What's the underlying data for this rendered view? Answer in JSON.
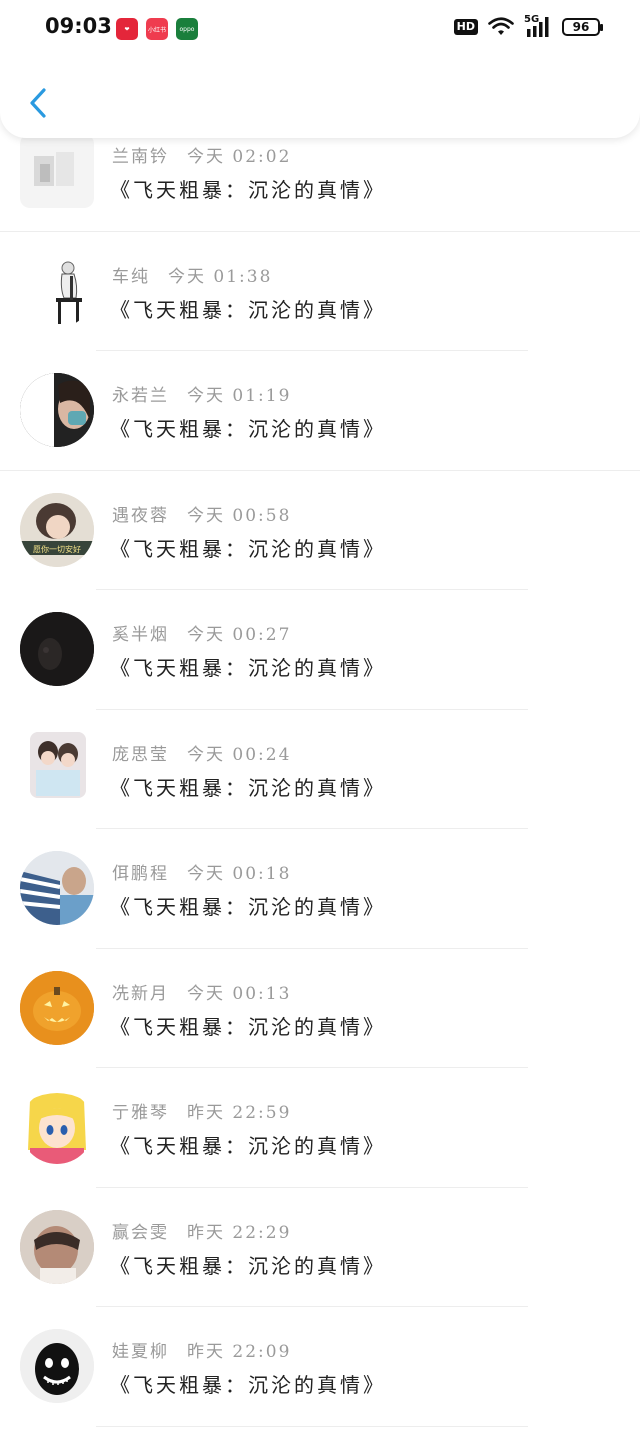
{
  "status_bar": {
    "time": "09:03",
    "badges": [
      {
        "text": "❤",
        "color": "#e4263a"
      },
      {
        "text": "小红书",
        "color": "#ef3c4f"
      },
      {
        "text": "oppo",
        "color": "#1a7f3c"
      }
    ],
    "hd": "HD",
    "network": "5G",
    "battery": "96"
  },
  "nav": {
    "back_icon": "chevron-left-icon"
  },
  "rows": [
    {
      "name": "兰南钤",
      "time": "今天 02:02",
      "title": "《飞天粗暴：沉沦的真情》"
    },
    {
      "name": "车纯",
      "time": "今天 01:38",
      "title": "《飞天粗暴：沉沦的真情》"
    },
    {
      "name": "永若兰",
      "time": "今天 01:19",
      "title": "《飞天粗暴：沉沦的真情》"
    },
    {
      "name": "遇夜蓉",
      "time": "今天 00:58",
      "title": "《飞天粗暴：沉沦的真情》"
    },
    {
      "name": "奚半烟",
      "time": "今天 00:27",
      "title": "《飞天粗暴：沉沦的真情》"
    },
    {
      "name": "庞思莹",
      "time": "今天 00:24",
      "title": "《飞天粗暴：沉沦的真情》"
    },
    {
      "name": "佴鹏程",
      "time": "今天 00:18",
      "title": "《飞天粗暴：沉沦的真情》"
    },
    {
      "name": "冼新月",
      "time": "今天 00:13",
      "title": "《飞天粗暴：沉沦的真情》"
    },
    {
      "name": "亍雅琴",
      "time": "昨天 22:59",
      "title": "《飞天粗暴：沉沦的真情》"
    },
    {
      "name": "赢会雯",
      "time": "昨天 22:29",
      "title": "《飞天粗暴：沉沦的真情》"
    },
    {
      "name": "娃夏柳",
      "time": "昨天 22:09",
      "title": "《飞天粗暴：沉沦的真情》"
    }
  ]
}
